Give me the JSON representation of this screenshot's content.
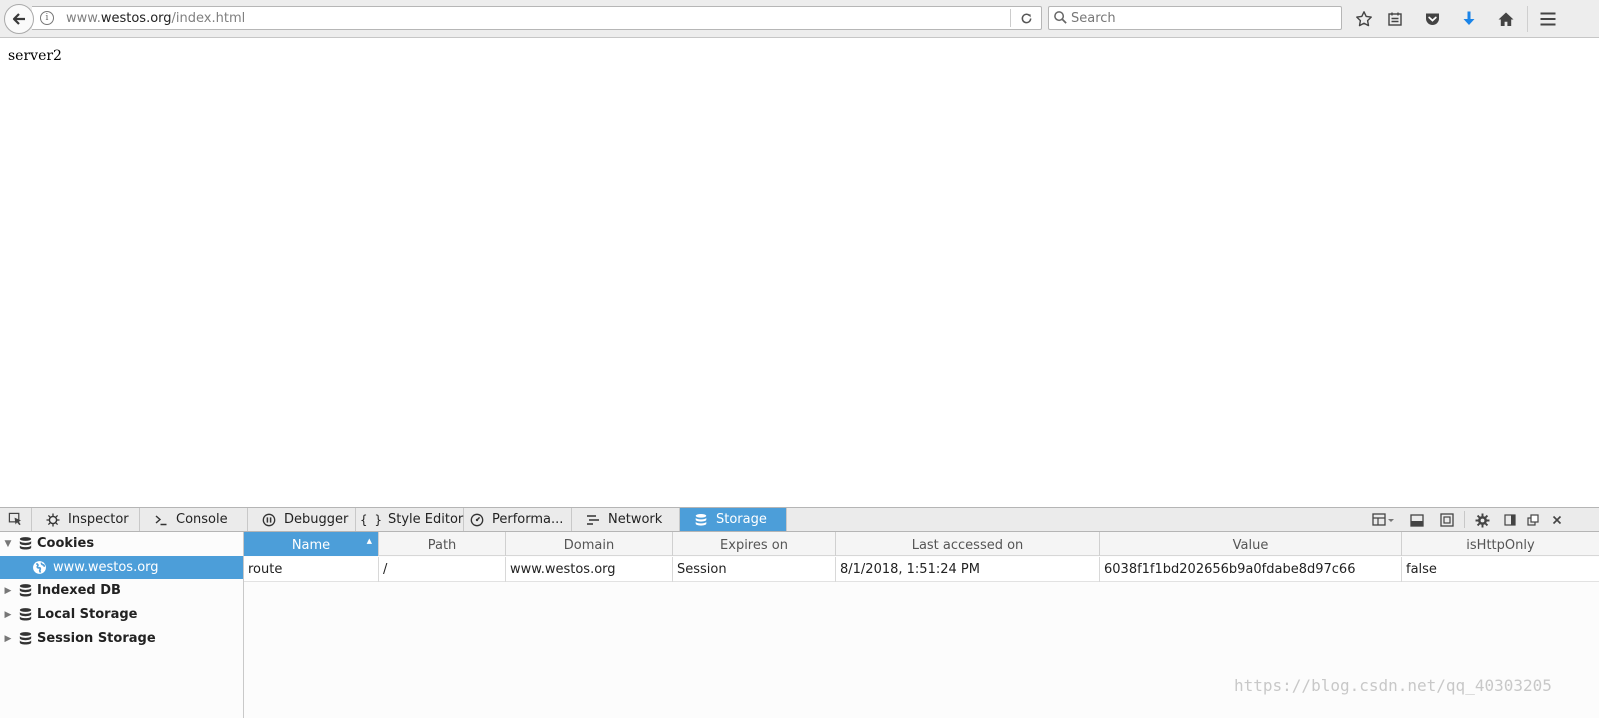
{
  "browser": {
    "url_prefix": "www.",
    "url_host": "westos.org",
    "url_path": "/index.html",
    "search_placeholder": "Search"
  },
  "page": {
    "body_text": "server2"
  },
  "devtools": {
    "tabs": [
      {
        "label": "Inspector",
        "icon": "gear-icon"
      },
      {
        "label": "Console",
        "icon": "console-icon"
      },
      {
        "label": "Debugger",
        "icon": "pause-icon"
      },
      {
        "label": "Style Editor",
        "icon": "braces-icon"
      },
      {
        "label": "Performa...",
        "icon": "gauge-icon"
      },
      {
        "label": "Network",
        "icon": "network-icon"
      },
      {
        "label": "Storage",
        "icon": "database-icon"
      }
    ],
    "active_tab": "Storage",
    "accent_color": "#4c9ed9"
  },
  "storage_tree": {
    "items": [
      {
        "label": "Cookies",
        "expanded": true
      },
      {
        "label": "www.westos.org",
        "selected": true
      },
      {
        "label": "Indexed DB",
        "expanded": false
      },
      {
        "label": "Local Storage",
        "expanded": false
      },
      {
        "label": "Session Storage",
        "expanded": false
      }
    ]
  },
  "cookies_table": {
    "columns": [
      "Name",
      "Path",
      "Domain",
      "Expires on",
      "Last accessed on",
      "Value",
      "isHttpOnly"
    ],
    "sorted_column": "Name",
    "rows": [
      [
        "route",
        "/",
        "www.westos.org",
        "Session",
        "8/1/2018, 1:51:24 PM",
        "6038f1f1bd202656b9a0fdabe8d97c66",
        "false"
      ]
    ]
  },
  "watermark": "https://blog.csdn.net/qq_40303205"
}
